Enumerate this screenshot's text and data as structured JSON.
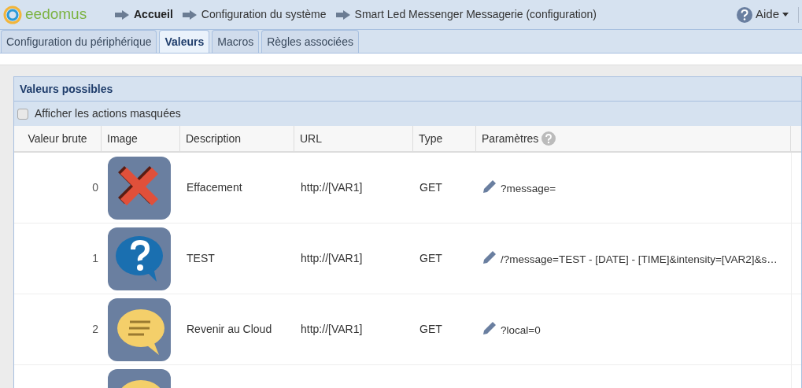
{
  "header": {
    "logo": "eedomus",
    "breadcrumbs": [
      {
        "label": "Accueil",
        "current": true
      },
      {
        "label": "Configuration du système",
        "current": false
      },
      {
        "label": "Smart Led Messenger Messagerie (configuration)",
        "current": false
      }
    ],
    "help": "Aide"
  },
  "tabs": [
    {
      "label": "Configuration du périphérique",
      "selected": false
    },
    {
      "label": "Valeurs",
      "selected": true
    },
    {
      "label": "Macros",
      "selected": false
    },
    {
      "label": "Règles associées",
      "selected": false
    }
  ],
  "panel": {
    "title": "Valeurs possibles",
    "show_hidden": {
      "label": "Afficher les actions masquées",
      "checked": false
    },
    "columns": [
      "Valeur brute",
      "Image",
      "Description",
      "URL",
      "Type",
      "Paramètres"
    ],
    "rows": [
      {
        "raw": "0",
        "kind": "cross",
        "description": "Effacement",
        "url": "http://[VAR1]",
        "type": "GET",
        "params": "?message="
      },
      {
        "raw": "1",
        "kind": "question",
        "description": "TEST",
        "url": "http://[VAR1]",
        "type": "GET",
        "params": "/?message=TEST - [DATE] - [TIME]&intensity=[VAR2]&s…"
      },
      {
        "raw": "2",
        "kind": "speech",
        "description": "Revenir au Cloud",
        "url": "http://[VAR1]",
        "type": "GET",
        "params": "?local=0"
      },
      {
        "kind": "speech"
      }
    ]
  }
}
